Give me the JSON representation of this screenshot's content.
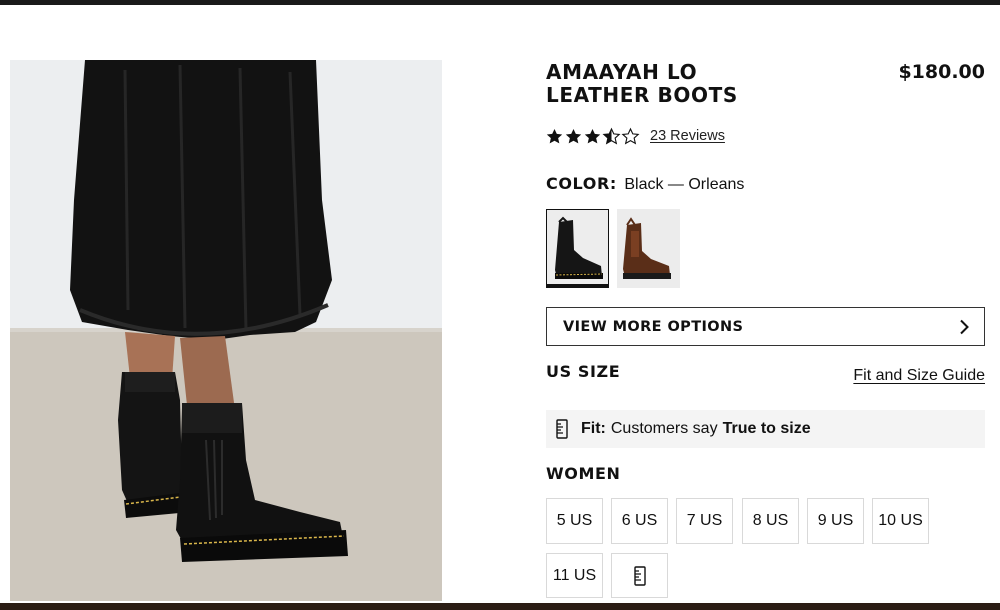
{
  "product": {
    "title_line1": "AMAAYAH LO",
    "title_line2": "LEATHER BOOTS",
    "price": "$180.00"
  },
  "rating": {
    "stars": 3.5,
    "max_stars": 5,
    "reviews_label": "23 Reviews"
  },
  "color": {
    "label": "COLOR:",
    "value": "Black — Orleans",
    "swatches": [
      {
        "name": "Black — Orleans",
        "selected": true,
        "color": "#151515"
      },
      {
        "name": "brown",
        "selected": false,
        "color": "#5a2e18"
      }
    ]
  },
  "options_button": {
    "label": "VIEW MORE OPTIONS",
    "icon": "chevron-right-icon"
  },
  "size": {
    "heading": "US SIZE",
    "guide_link": "Fit and Size Guide",
    "fit_label": "Fit:",
    "fit_text": "Customers say",
    "fit_value": "True to size",
    "fit_icon": "ruler-icon",
    "women_heading": "WOMEN",
    "options": [
      "5 US",
      "6 US",
      "7 US",
      "8 US",
      "9 US",
      "10 US",
      "11 US"
    ],
    "extra_icon": "ruler-icon"
  },
  "colors": {
    "text": "#111111",
    "border": "#d9d9d9",
    "fit_bg": "#f4f4f4"
  }
}
